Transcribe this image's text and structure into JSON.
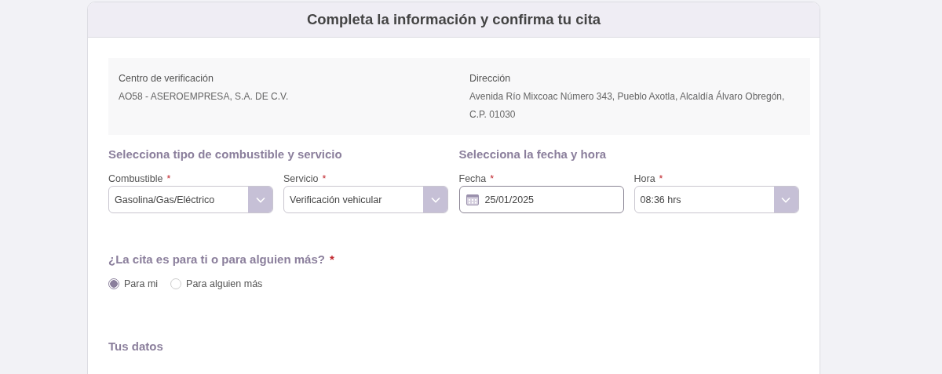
{
  "header": {
    "title": "Completa la información y confirma tu cita"
  },
  "info": [
    {
      "label": "Centro de verificación",
      "value": "AO58 - ASEROEMPRESA, S.A. DE C.V."
    },
    {
      "label": "Dirección",
      "value": "Avenida Río Mixcoac Número 343, Pueblo Axotla, Alcaldía Álvaro Obregón, C.P. 01030"
    }
  ],
  "sections": [
    {
      "title": "Selecciona tipo de combustible y servicio",
      "fields": [
        {
          "label": "Combustible",
          "required_mark": "*",
          "kind": "select",
          "value": "Gasolina/Gas/Eléctrico"
        },
        {
          "label": "Servicio",
          "required_mark": "*",
          "kind": "select",
          "value": "Verificación vehicular"
        }
      ]
    },
    {
      "title": "Selecciona la fecha y hora",
      "fields": [
        {
          "label": "Fecha",
          "required_mark": "*",
          "kind": "date",
          "value": "25/01/2025"
        },
        {
          "label": "Hora",
          "required_mark": "*",
          "kind": "select",
          "value": "08:36 hrs"
        }
      ]
    }
  ],
  "question": {
    "text": "¿La cita es para ti o para alguien más?",
    "required_mark": "*",
    "options": [
      {
        "label": "Para mi",
        "selected": true
      },
      {
        "label": "Para alguien más",
        "selected": false
      }
    ]
  },
  "next_section": {
    "title": "Tus datos"
  }
}
